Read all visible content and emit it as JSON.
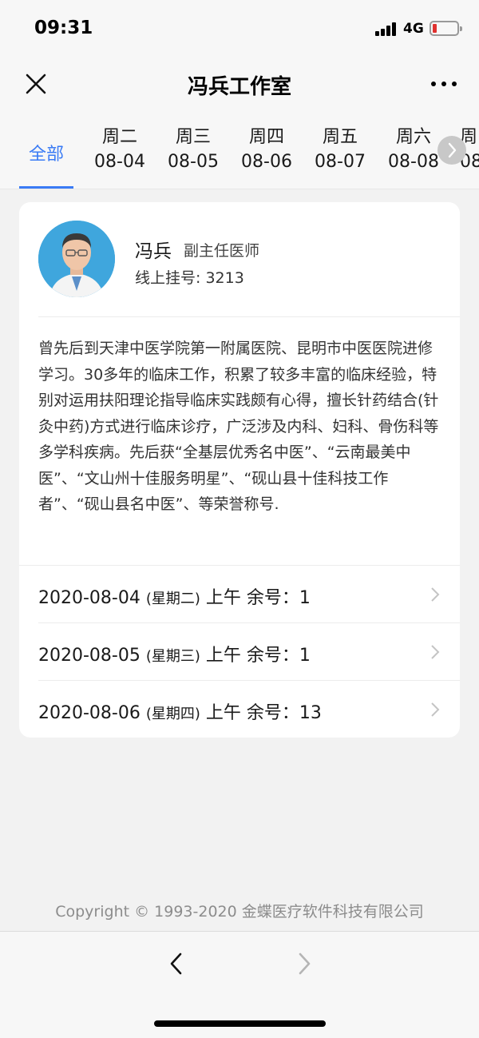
{
  "status_bar": {
    "time": "09:31",
    "network": "4G"
  },
  "nav": {
    "title": "冯兵工作室"
  },
  "tabs": {
    "all_label": "全部",
    "days": [
      {
        "weekday": "周二",
        "date": "08-04"
      },
      {
        "weekday": "周三",
        "date": "08-05"
      },
      {
        "weekday": "周四",
        "date": "08-06"
      },
      {
        "weekday": "周五",
        "date": "08-07"
      },
      {
        "weekday": "周六",
        "date": "08-08"
      },
      {
        "weekday": "周",
        "date": "08"
      }
    ]
  },
  "doctor": {
    "name": "冯兵",
    "title": "副主任医师",
    "registrations": "线上挂号: 3213",
    "intro": "曾先后到天津中医学院第一附属医院、昆明市中医医院进修学习。30多年的临床工作，积累了较多丰富的临床经验，特别对运用扶阳理论指导临床实践颇有心得，擅长针药结合(针灸中药)方式进行临床诊疗，广泛涉及内科、妇科、骨伤科等多学科疾病。先后获“全基层优秀名中医”、“云南最美中医”、“文山州十佳服务明星”、“砚山县十佳科技工作者”、“砚山县名中医”、等荣誉称号."
  },
  "schedule": [
    {
      "date": "2020-08-04",
      "weekday": "(星期二)",
      "detail": "上午 余号：1"
    },
    {
      "date": "2020-08-05",
      "weekday": "(星期三)",
      "detail": "上午 余号：1"
    },
    {
      "date": "2020-08-06",
      "weekday": "(星期四)",
      "detail": "上午 余号：13"
    }
  ],
  "footer": {
    "copyright": "Copyright © 1993-2020 金蝶医疗软件科技有限公司"
  },
  "colors": {
    "accent": "#3a7bf5",
    "background": "#f2f2f2",
    "card": "#ffffff"
  }
}
